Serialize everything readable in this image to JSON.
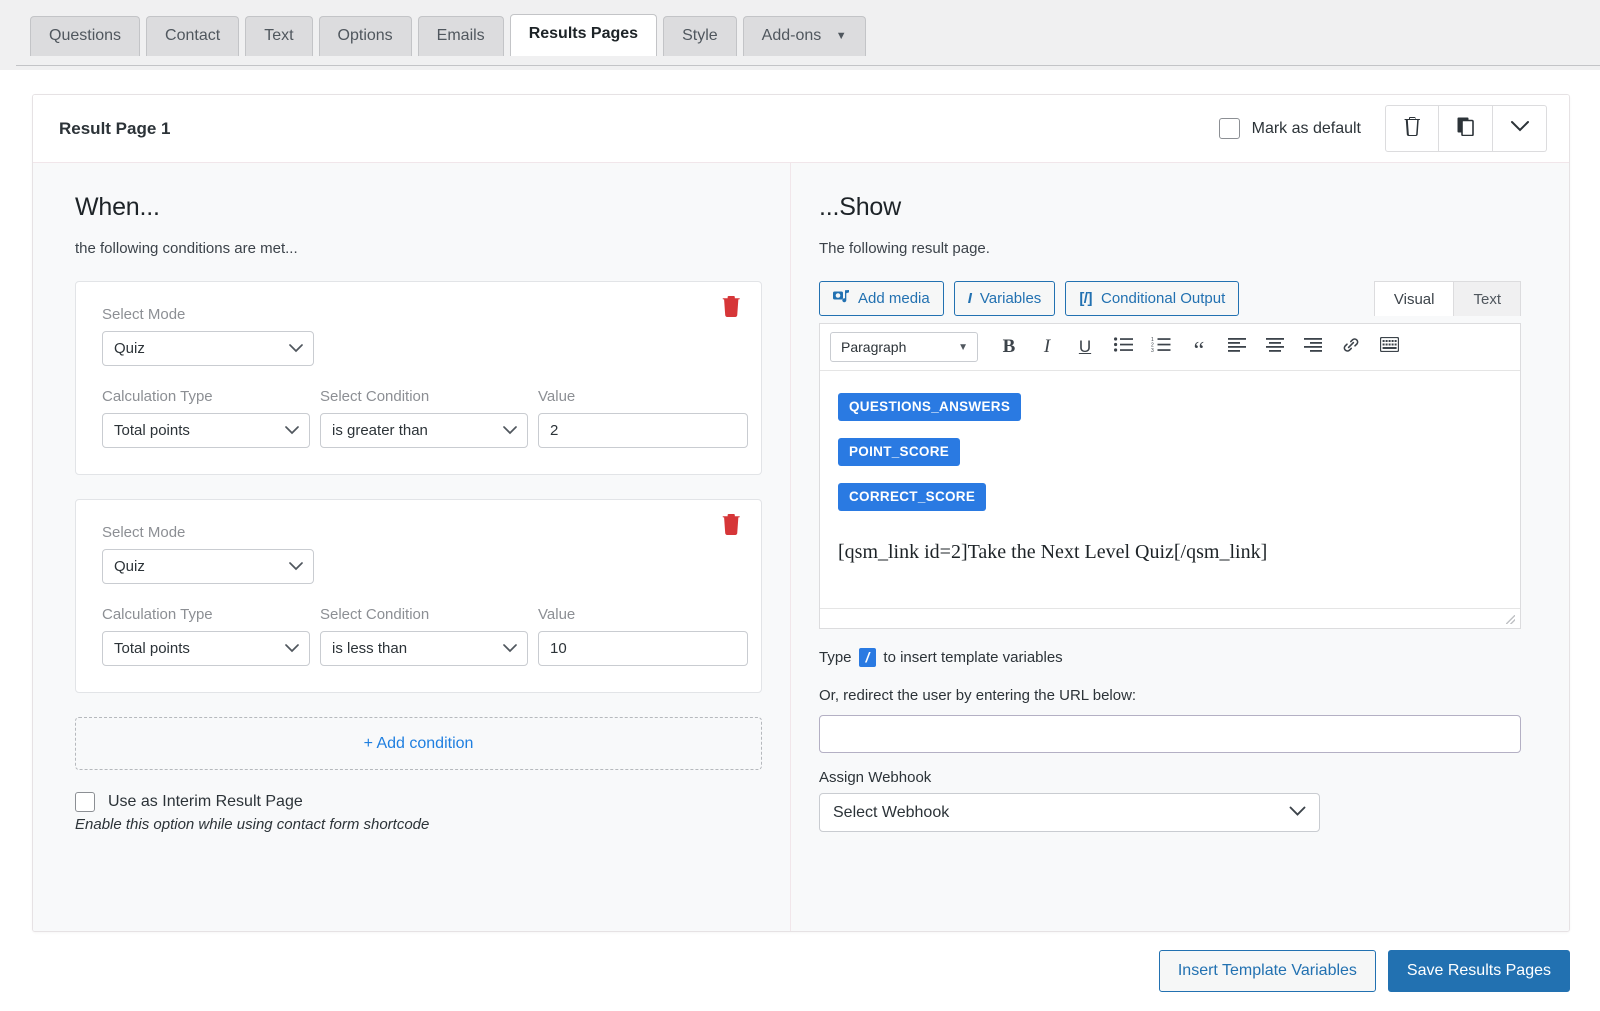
{
  "tabs": [
    {
      "label": "Questions",
      "active": false
    },
    {
      "label": "Contact",
      "active": false
    },
    {
      "label": "Text",
      "active": false
    },
    {
      "label": "Options",
      "active": false
    },
    {
      "label": "Emails",
      "active": false
    },
    {
      "label": "Results Pages",
      "active": true
    },
    {
      "label": "Style",
      "active": false
    },
    {
      "label": "Add-ons",
      "active": false,
      "caret": "▼"
    }
  ],
  "card_header": {
    "title": "Result Page 1",
    "mark_as_default": "Mark as default",
    "mark_as_default_checked": false,
    "icons": [
      "trash-icon",
      "duplicate-icon",
      "chevron-down-icon"
    ]
  },
  "when": {
    "heading": "When...",
    "subheading": "the following conditions are met...",
    "labels": {
      "mode": "Select Mode",
      "calc": "Calculation Type",
      "cond": "Select Condition",
      "value": "Value"
    },
    "conditions": [
      {
        "mode": "Quiz",
        "calc": "Total points",
        "cond": "is greater than",
        "value": "2"
      },
      {
        "mode": "Quiz",
        "calc": "Total points",
        "cond": "is less than",
        "value": "10"
      }
    ],
    "add_condition": "+ Add condition",
    "interim_label": "Use as Interim Result Page",
    "interim_checked": false,
    "interim_note": "Enable this option while using contact form shortcode"
  },
  "show": {
    "heading": "...Show",
    "subheading": "The following result page.",
    "buttons": {
      "add_media": "Add media",
      "variables": "Variables",
      "variables_prefix": "I",
      "conditional_output": "Conditional Output",
      "conditional_prefix": "[/]"
    },
    "editor_tabs": [
      {
        "label": "Visual",
        "active": true
      },
      {
        "label": "Text",
        "active": false
      }
    ],
    "format_bar": {
      "paragraph": "Paragraph",
      "bold": "B",
      "italic": "I",
      "underline": "U",
      "quote": "“"
    },
    "content": {
      "variables": [
        "QUESTIONS_ANSWERS",
        "POINT_SCORE",
        "CORRECT_SCORE"
      ],
      "shortcode": "[qsm_link id=2]Take the Next Level Quiz[/qsm_link]"
    },
    "hint_prefix": "Type",
    "hint_slash": "/",
    "hint_suffix": "to insert template variables",
    "redirect_label": "Or, redirect the user by entering the URL below:",
    "redirect_value": "",
    "redirect_placeholder": "",
    "webhook_label": "Assign Webhook",
    "webhook_value": "Select Webhook"
  },
  "footer": {
    "insert_template_variables": "Insert Template Variables",
    "save_results_pages": "Save Results Pages"
  },
  "colors": {
    "accent_blue": "#2271b1",
    "chip_blue": "#2a7ae2",
    "danger_red": "#d63638",
    "page_bg": "#f0f0f1",
    "pane_bg": "#f8f9fa"
  }
}
